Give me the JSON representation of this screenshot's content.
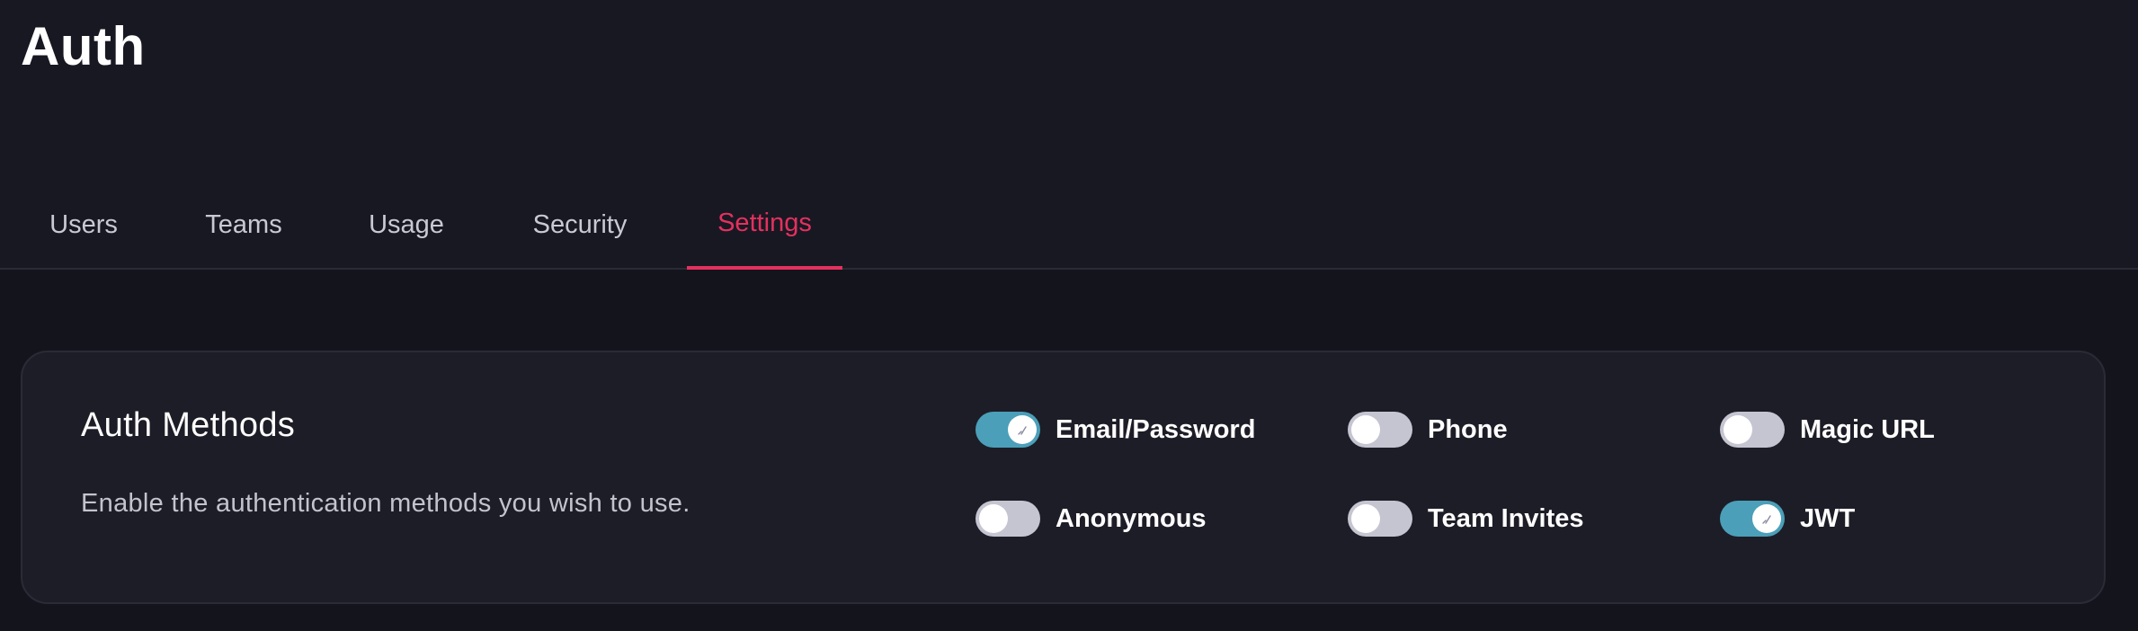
{
  "header": {
    "title": "Auth"
  },
  "tabs": [
    {
      "label": "Users",
      "active": false
    },
    {
      "label": "Teams",
      "active": false
    },
    {
      "label": "Usage",
      "active": false
    },
    {
      "label": "Security",
      "active": false
    },
    {
      "label": "Settings",
      "active": true
    }
  ],
  "auth_methods": {
    "title": "Auth Methods",
    "description": "Enable the authentication methods you wish to use.",
    "methods": [
      {
        "label": "Email/Password",
        "enabled": true
      },
      {
        "label": "Phone",
        "enabled": false
      },
      {
        "label": "Magic URL",
        "enabled": false
      },
      {
        "label": "Anonymous",
        "enabled": false
      },
      {
        "label": "Team Invites",
        "enabled": false
      },
      {
        "label": "JWT",
        "enabled": true
      }
    ]
  },
  "colors": {
    "accent": "#e3315e",
    "toggle_on": "#4b9fb9",
    "toggle_off": "#c5c5d2",
    "background": "#16161f"
  },
  "icons": {
    "toggle_on_indicator": "check-icon"
  }
}
